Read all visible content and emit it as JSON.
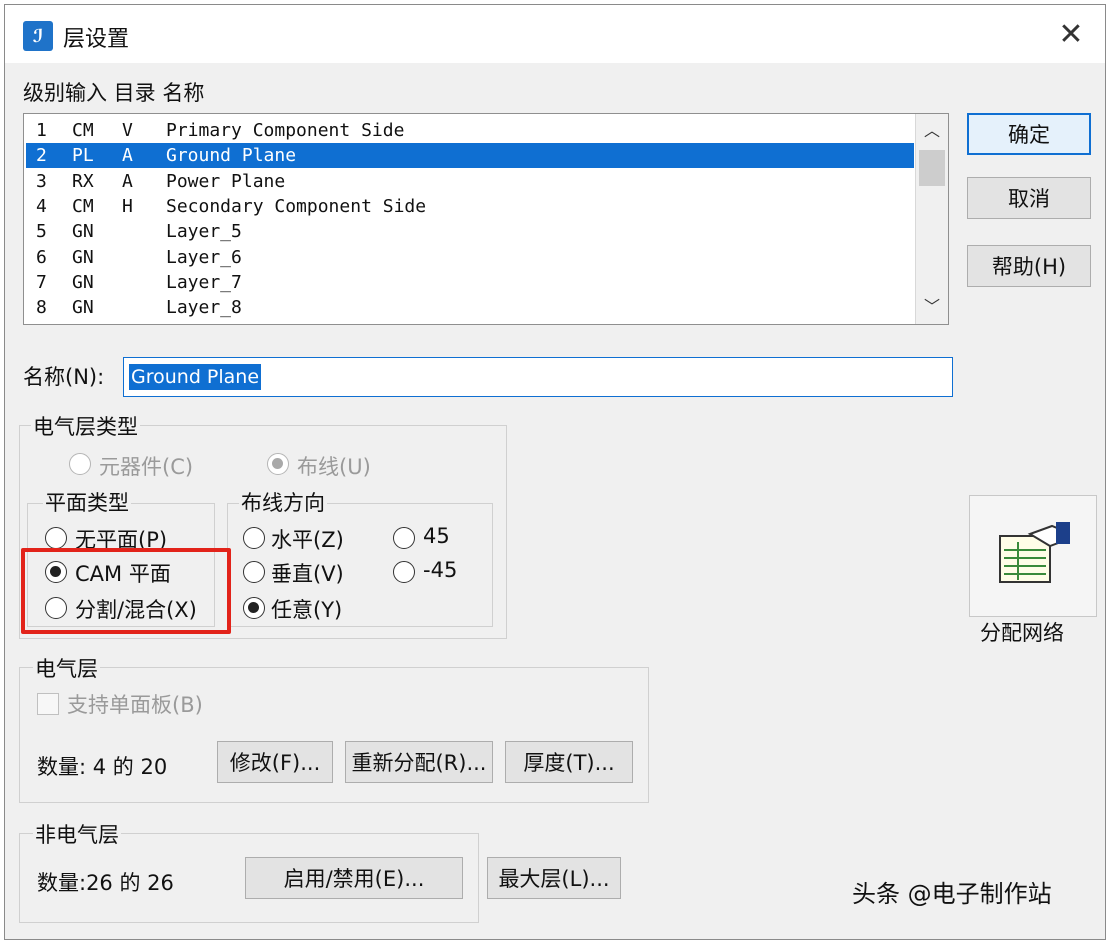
{
  "window": {
    "title": "层设置",
    "close_label": "✕"
  },
  "list_header": "级别输入 目录 名称",
  "layers": [
    {
      "num": "1",
      "type": "CM",
      "dir": "V",
      "name": "Primary Component Side",
      "selected": false
    },
    {
      "num": "2",
      "type": "PL",
      "dir": "A",
      "name": "Ground Plane",
      "selected": true
    },
    {
      "num": "3",
      "type": "RX",
      "dir": "A",
      "name": "Power Plane",
      "selected": false
    },
    {
      "num": "4",
      "type": "CM",
      "dir": "H",
      "name": "Secondary Component Side",
      "selected": false
    },
    {
      "num": "5",
      "type": "GN",
      "dir": "",
      "name": "Layer_5",
      "selected": false
    },
    {
      "num": "6",
      "type": "GN",
      "dir": "",
      "name": "Layer_6",
      "selected": false
    },
    {
      "num": "7",
      "type": "GN",
      "dir": "",
      "name": "Layer_7",
      "selected": false
    },
    {
      "num": "8",
      "type": "GN",
      "dir": "",
      "name": "Layer_8",
      "selected": false
    }
  ],
  "buttons": {
    "ok": "确定",
    "cancel": "取消",
    "help": "帮助(H)"
  },
  "name_field": {
    "label": "名称(N):",
    "value": "Ground Plane"
  },
  "elec_type": {
    "title": "电气层类型",
    "component": "元器件(C)",
    "routing": "布线(U)",
    "plane_type": {
      "title": "平面类型",
      "none": "无平面(P)",
      "cam": "CAM 平面",
      "split": "分割/混合(X)"
    },
    "routing_dir": {
      "title": "布线方向",
      "horizontal": "水平(Z)",
      "vertical": "垂直(V)",
      "any": "任意(Y)",
      "d45": "45",
      "dm45": "-45"
    }
  },
  "assign_nets": "分配网络",
  "elec_layers": {
    "title": "电气层",
    "single_sided": "支持单面板(B)",
    "count": "数量: 4 的 20",
    "modify": "修改(F)...",
    "reassign": "重新分配(R)...",
    "thickness": "厚度(T)..."
  },
  "nonelec_layers": {
    "title": "非电气层",
    "count": "数量:26 的 26",
    "enable": "启用/禁用(E)...",
    "max": "最大层(L)..."
  },
  "watermark_footer": "头条 @电子制作站",
  "colors": {
    "selection": "#0f6fd2",
    "highlight_box": "#e2231a"
  }
}
